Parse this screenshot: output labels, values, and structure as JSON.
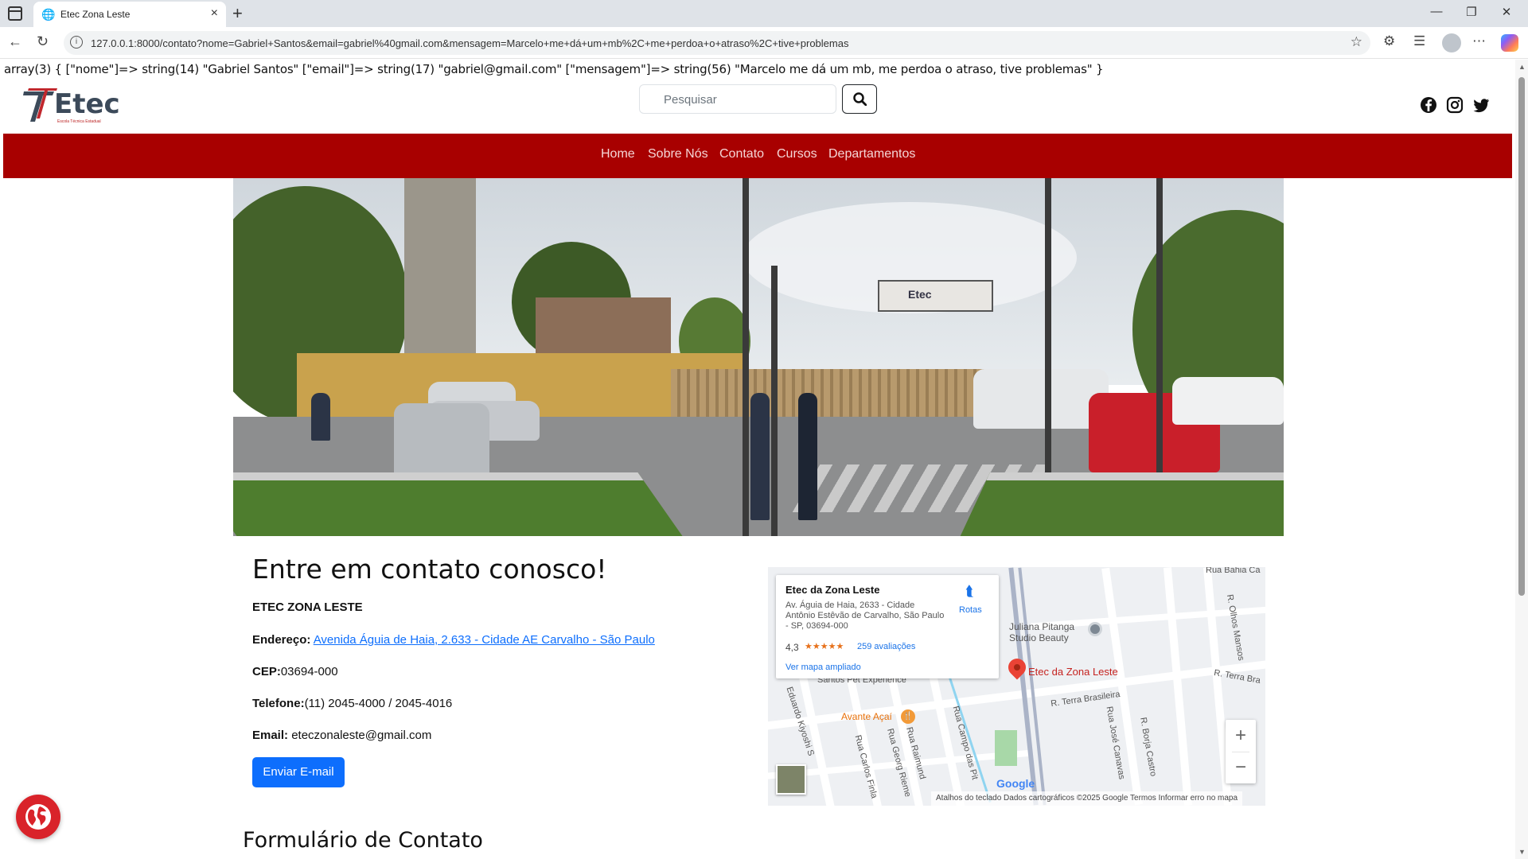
{
  "browser": {
    "tab_title": "Etec Zona Leste",
    "url": "127.0.0.1:8000/contato?nome=Gabriel+Santos&email=gabriel%40gmail.com&mensagem=Marcelo+me+dá+um+mb%2C+me+perdoa+o+atraso%2C+tive+problemas"
  },
  "debug_output": "array(3) { [\"nome\"]=> string(14) \"Gabriel Santos\" [\"email\"]=> string(17) \"gabriel@gmail.com\" [\"mensagem\"]=> string(56) \"Marcelo me dá um mb, me perdoa o atraso, tive problemas\" }",
  "header": {
    "logo_text": "Etec",
    "logo_subtext": "Escola Técnica Estadual",
    "search_placeholder": "Pesquisar"
  },
  "nav": {
    "items": [
      "Home",
      "Sobre Nós",
      "Contato",
      "Cursos",
      "Departamentos"
    ]
  },
  "hero": {
    "sign_text": "Etec"
  },
  "contact": {
    "title": "Entre em contato conosco!",
    "school": "ETEC ZONA LESTE",
    "address_label": "Endereço:",
    "address_value": "Avenida Águia de Haia, 2.633 - Cidade AE Carvalho - São Paulo",
    "cep_label": "CEP:",
    "cep_value": "03694-000",
    "phone_label": "Telefone:",
    "phone_value": "(11) 2045-4000 / 2045-4016",
    "email_label": "Email:",
    "email_value": "eteczonaleste@gmail.com",
    "email_button": "Enviar E-mail"
  },
  "map": {
    "place_name": "Etec da Zona Leste",
    "place_address": "Av. Águia de Haia, 2633 - Cidade Antônio Estêvão de Carvalho, São Paulo - SP, 03694-000",
    "rating": "4,3",
    "stars": "★★★★★",
    "reviews": "259 avaliações",
    "view_larger": "Ver mapa ampliado",
    "directions": "Rotas",
    "pin_label": "Etec da Zona Leste",
    "poi_1": "Avante Açaí",
    "poi_2": "Juliana Pitanga Studio Beauty",
    "streets": [
      "R. Terra Brasileira",
      "R. Terra Bra",
      "Rua José Canavas",
      "R. Borja Castro",
      "Rua Campo das Pit",
      "Rua Raimund",
      "Rua Georg Rieme",
      "Rua Carlos Finla",
      "Eduardo Kiyoshi S",
      "R. Olhos Mansos",
      "Rua Bahia Ca",
      "Santos Pet Experience"
    ],
    "google": "Google",
    "attribution": "Atalhos do teclado    Dados cartográficos ©2025 Google    Termos    Informar erro no mapa"
  },
  "form": {
    "title": "Formulário de Contato"
  },
  "colors": {
    "nav_red": "#a80000",
    "button_blue": "#0d6efd",
    "link_blue": "#0d6efd"
  }
}
